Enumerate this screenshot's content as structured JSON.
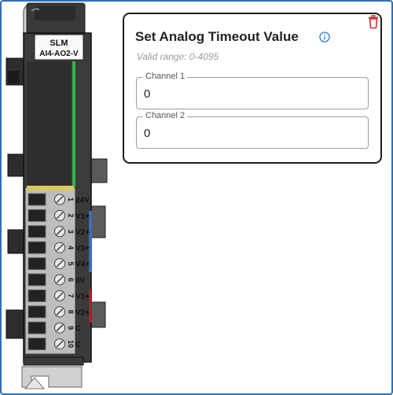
{
  "module": {
    "brand": "SLM",
    "model": "AI4-AO2-V",
    "terminals": [
      {
        "pin": "1",
        "label": "24V"
      },
      {
        "pin": "2",
        "label": "V1+"
      },
      {
        "pin": "3",
        "label": "V2+"
      },
      {
        "pin": "4",
        "label": "V3+"
      },
      {
        "pin": "5",
        "label": "V4+"
      },
      {
        "pin": "6",
        "label": "0V"
      },
      {
        "pin": "7",
        "label": "V1+"
      },
      {
        "pin": "8",
        "label": "V2+"
      },
      {
        "pin": "9",
        "label": "C"
      },
      {
        "pin": "10",
        "label": "C"
      }
    ],
    "colors": {
      "input_bar": "#3a6db5",
      "output_bar": "#a3232b",
      "status_led": "#2fb54a"
    }
  },
  "dialog": {
    "title": "Set Analog Timeout Value",
    "subtitle": "Valid range: 0-4095",
    "info_icon": "info-icon",
    "delete_icon": "trash-icon",
    "fields": [
      {
        "label": "Channel 1",
        "value": "0"
      },
      {
        "label": "Channel 2",
        "value": "0"
      }
    ],
    "colors": {
      "info": "#2a7bd4",
      "delete": "#d32f2f",
      "border": "#1d1d1d",
      "frame": "#2f6fb7"
    }
  }
}
